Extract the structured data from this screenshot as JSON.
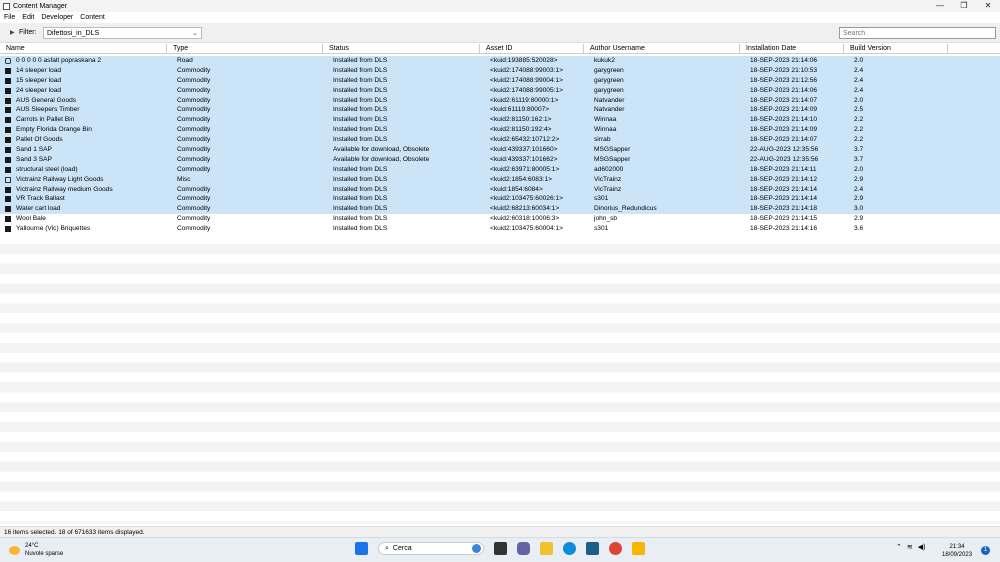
{
  "window": {
    "title": "Content Manager",
    "minimize": "—",
    "maximize": "❐",
    "close": "✕"
  },
  "menu": [
    "File",
    "Edit",
    "Developer",
    "Content"
  ],
  "filter": {
    "label": "Filter:",
    "value": "Difettosi_in_DLS",
    "search_placeholder": "Search"
  },
  "columns": [
    "Name",
    "Type",
    "Status",
    "Asset ID",
    "Author Username",
    "Installation Date",
    "Build Version"
  ],
  "rows": [
    {
      "icon": "road-icon",
      "name": "0 0 0 0 0 asfalt popraskana 2",
      "type": "Road",
      "status": "Installed from DLS",
      "asset_id": "<kuid:193885:520028>",
      "author": "kukuk2",
      "date": "18-SEP-2023 21:14:06",
      "build": "2.0"
    },
    {
      "icon": "commodity-icon",
      "name": "14 sleeper load",
      "type": "Commodity",
      "status": "Installed from DLS",
      "asset_id": "<kuid2:174088:99003:1>",
      "author": "garygreen",
      "date": "18-SEP-2023 21:10:53",
      "build": "2.4"
    },
    {
      "icon": "commodity-icon",
      "name": "15 sleeper load",
      "type": "Commodity",
      "status": "Installed from DLS",
      "asset_id": "<kuid2:174088:99004:1>",
      "author": "garygreen",
      "date": "18-SEP-2023 21:12:56",
      "build": "2.4"
    },
    {
      "icon": "commodity-icon",
      "name": "24 sleeper load",
      "type": "Commodity",
      "status": "Installed from DLS",
      "asset_id": "<kuid2:174088:99005:1>",
      "author": "garygreen",
      "date": "18-SEP-2023 21:14:06",
      "build": "2.4"
    },
    {
      "icon": "commodity-icon",
      "name": "AUS General Goods",
      "type": "Commodity",
      "status": "Installed from DLS",
      "asset_id": "<kuid2:61119:80000:1>",
      "author": "Natvander",
      "date": "18-SEP-2023 21:14:07",
      "build": "2.0"
    },
    {
      "icon": "commodity-icon",
      "name": "AUS Sleepers Timber",
      "type": "Commodity",
      "status": "Installed from DLS",
      "asset_id": "<kuid:61119:80007>",
      "author": "Natvander",
      "date": "18-SEP-2023 21:14:09",
      "build": "2.5"
    },
    {
      "icon": "commodity-icon",
      "name": "Carrots in Pallet Bin",
      "type": "Commodity",
      "status": "Installed from DLS",
      "asset_id": "<kuid2:81150:162:1>",
      "author": "Winnaa",
      "date": "18-SEP-2023 21:14:10",
      "build": "2.2"
    },
    {
      "icon": "commodity-icon",
      "name": "Empty Florida Orange Bin",
      "type": "Commodity",
      "status": "Installed from DLS",
      "asset_id": "<kuid2:81150:192:4>",
      "author": "Winnaa",
      "date": "18-SEP-2023 21:14:09",
      "build": "2.2"
    },
    {
      "icon": "commodity-icon",
      "name": "Pallet Of Goods",
      "type": "Commodity",
      "status": "Installed from DLS",
      "asset_id": "<kuid2:65432:10712:2>",
      "author": "sirrab",
      "date": "18-SEP-2023 21:14:07",
      "build": "2.2"
    },
    {
      "icon": "commodity-icon",
      "name": "Sand 1 SAP",
      "type": "Commodity",
      "status": "Available for download, Obsolete",
      "asset_id": "<kuid:439337:101660>",
      "author": "MSGSapper",
      "date": "22-AUG-2023 12:35:56",
      "build": "3.7"
    },
    {
      "icon": "commodity-icon",
      "name": "Sand 3 SAP",
      "type": "Commodity",
      "status": "Available for download, Obsolete",
      "asset_id": "<kuid:439337:101662>",
      "author": "MSGSapper",
      "date": "22-AUG-2023 12:35:56",
      "build": "3.7"
    },
    {
      "icon": "commodity-icon",
      "name": "structural steel (load)",
      "type": "Commodity",
      "status": "Installed from DLS",
      "asset_id": "<kuid2:63971:80005:1>",
      "author": "ad602000",
      "date": "18-SEP-2023 21:14:11",
      "build": "2.0"
    },
    {
      "icon": "misc-icon",
      "name": "Victrainz Railway Light Goods",
      "type": "Misc",
      "status": "Installed from DLS",
      "asset_id": "<kuid2:1854:6083:1>",
      "author": "VicTrainz",
      "date": "18-SEP-2023 21:14:12",
      "build": "2.9"
    },
    {
      "icon": "commodity-icon",
      "name": "Victrainz Railway medium Goods",
      "type": "Commodity",
      "status": "Installed from DLS",
      "asset_id": "<kuid:1854:6084>",
      "author": "VicTrainz",
      "date": "18-SEP-2023 21:14:14",
      "build": "2.4"
    },
    {
      "icon": "commodity-icon",
      "name": "VR Track Ballast",
      "type": "Commodity",
      "status": "Installed from DLS",
      "asset_id": "<kuid2:103475:60026:1>",
      "author": "s301",
      "date": "18-SEP-2023 21:14:14",
      "build": "2.9"
    },
    {
      "icon": "commodity-icon",
      "name": "Water cart load",
      "type": "Commodity",
      "status": "Installed from DLS",
      "asset_id": "<kuid2:68213:60034:1>",
      "author": "Dinorius_Redundicus",
      "date": "18-SEP-2023 21:14:18",
      "build": "3.0"
    },
    {
      "icon": "commodity-icon",
      "name": "Wool Bale",
      "type": "Commodity",
      "status": "Installed from DLS",
      "asset_id": "<kuid2:60318:10006:3>",
      "author": "john_sb",
      "date": "18-SEP-2023 21:14:15",
      "build": "2.9"
    },
    {
      "icon": "commodity-icon",
      "name": "Yallourne (Vic) Briquettes",
      "type": "Commodity",
      "status": "Installed from DLS",
      "asset_id": "<kuid2:103475:60004:1>",
      "author": "s301",
      "date": "18-SEP-2023 21:14:16",
      "build": "3.6"
    }
  ],
  "status_text": "16 items selected. 18 of 671633 items displayed.",
  "taskbar": {
    "weather_temp": "24°C",
    "weather_desc": "Nuvole sparse",
    "search_label": "Cerca",
    "time": "21:34",
    "date": "18/09/2023",
    "notification_count": "1"
  }
}
